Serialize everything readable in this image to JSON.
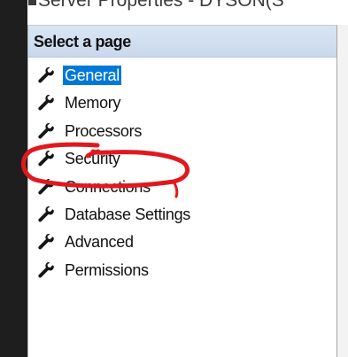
{
  "window": {
    "title": "Server Properties - DYSON(S"
  },
  "page_selector": {
    "header": "Select a page",
    "items": [
      {
        "label": "General",
        "icon": "wrench-icon",
        "selected": true
      },
      {
        "label": "Memory",
        "icon": "wrench-icon",
        "selected": false
      },
      {
        "label": "Processors",
        "icon": "wrench-icon",
        "selected": false
      },
      {
        "label": "Security",
        "icon": "wrench-icon",
        "selected": false
      },
      {
        "label": "Connections",
        "icon": "wrench-icon",
        "selected": false
      },
      {
        "label": "Database Settings",
        "icon": "wrench-icon",
        "selected": false
      },
      {
        "label": "Advanced",
        "icon": "wrench-icon",
        "selected": false
      },
      {
        "label": "Permissions",
        "icon": "wrench-icon",
        "selected": false
      }
    ]
  },
  "colors": {
    "selection": "#0078d7",
    "header_bg": "#d1dff1",
    "annotation": "#e0191e"
  },
  "annotation": {
    "shape": "hand-drawn-circle",
    "target": "Security"
  }
}
